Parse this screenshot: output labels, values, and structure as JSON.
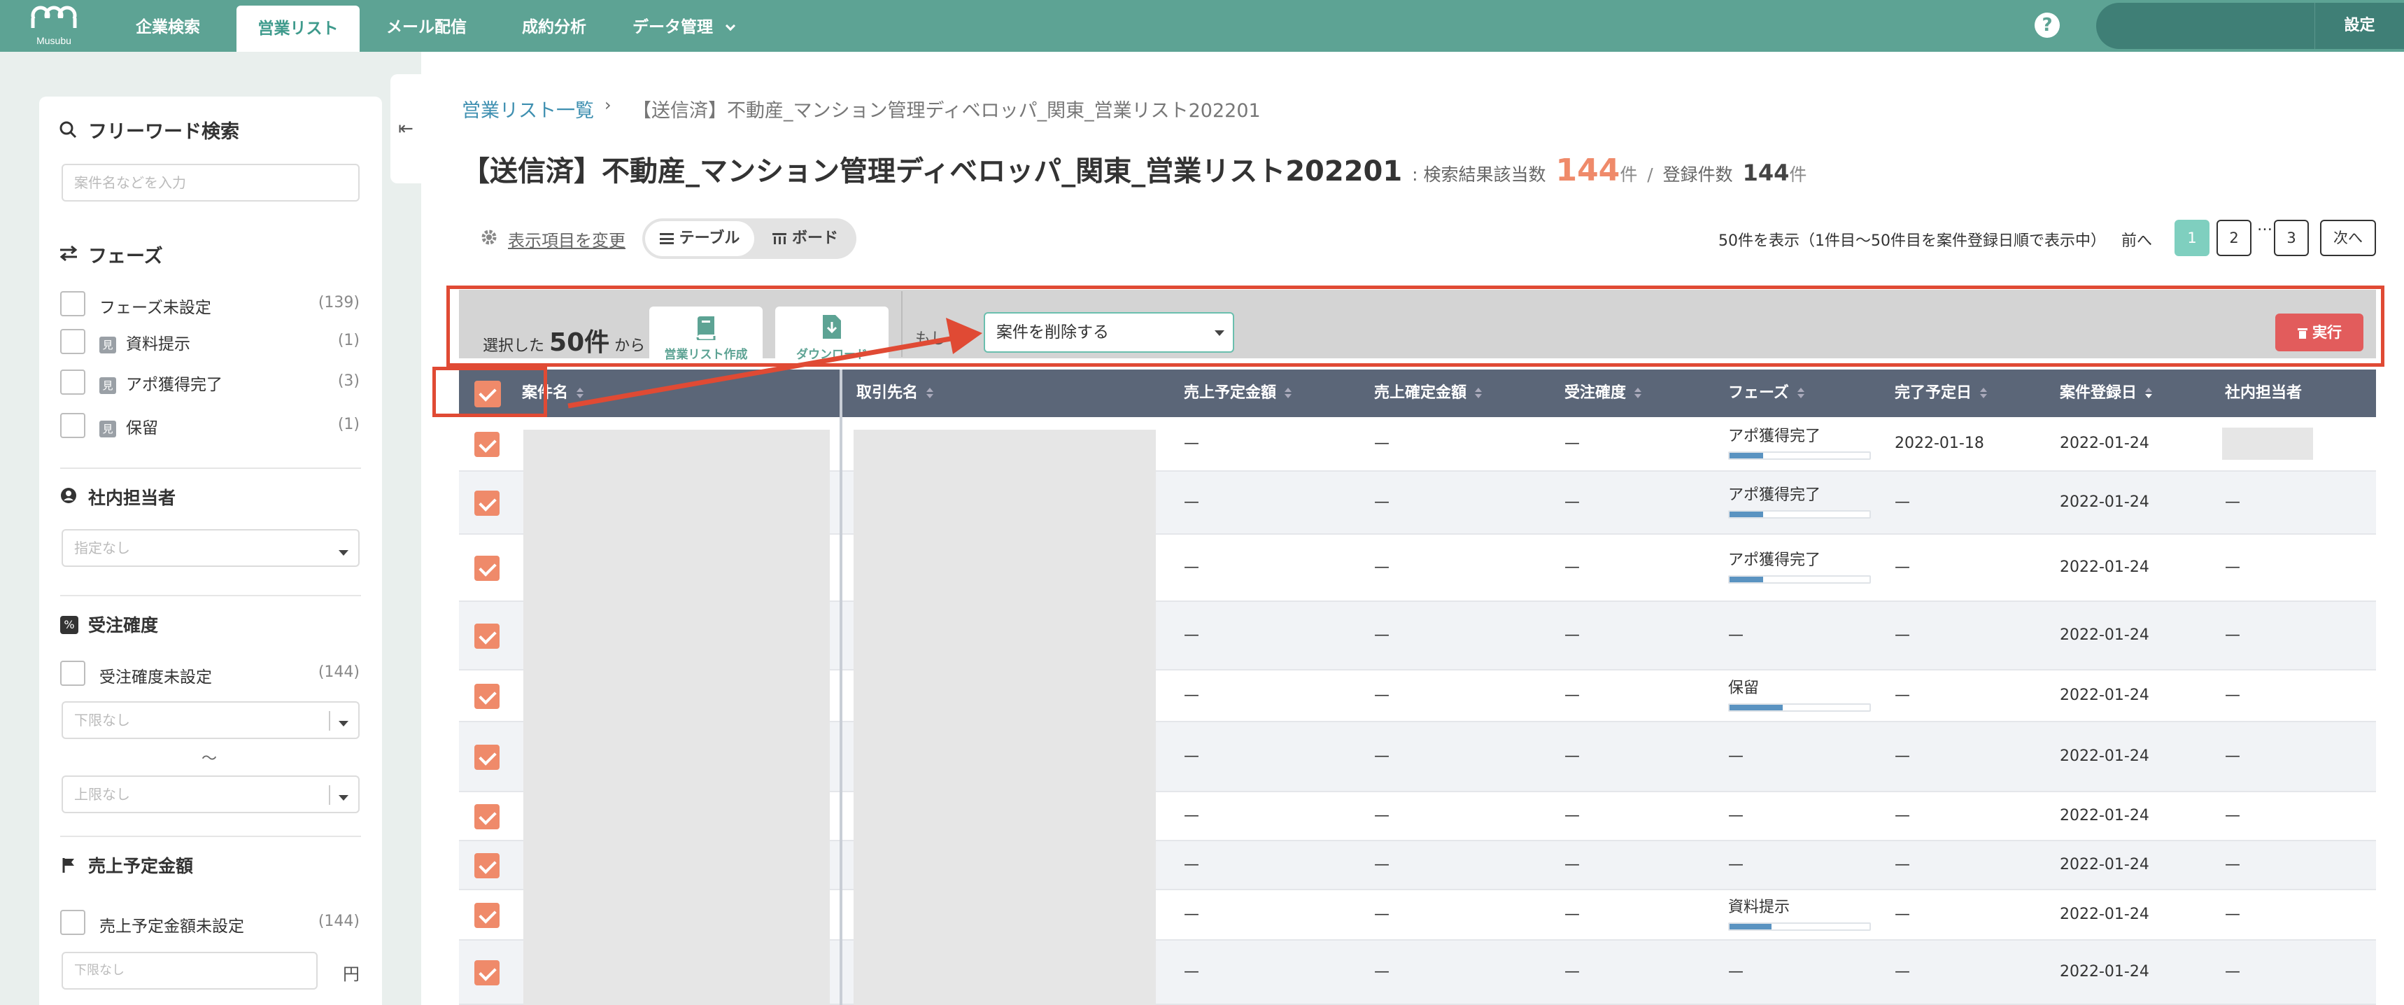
{
  "header": {
    "logo_text": "Musubu",
    "nav": [
      "企業検索",
      "営業リスト",
      "メール配信",
      "成約分析",
      "データ管理"
    ],
    "active_nav": "営業リスト",
    "help": "?",
    "settings": "設定"
  },
  "sidebar": {
    "freeword_title": "フリーワード検索",
    "freeword_placeholder": "案件名などを入力",
    "phase_title": "フェーズ",
    "phase_items": [
      {
        "label": "フェーズ未設定",
        "count": "(139)",
        "tag": ""
      },
      {
        "label": "資料提示",
        "count": "(1)",
        "tag": "見"
      },
      {
        "label": "アポ獲得完了",
        "count": "(3)",
        "tag": "見"
      },
      {
        "label": "保留",
        "count": "(1)",
        "tag": "見"
      }
    ],
    "owner_title": "社内担当者",
    "owner_select": "指定なし",
    "prob_title": "受注確度",
    "prob_unset_label": "受注確度未設定",
    "prob_unset_count": "(144)",
    "prob_lower": "下限なし",
    "prob_tilde": "〜",
    "prob_upper": "上限なし",
    "sales_title": "売上予定金額",
    "sales_unset_label": "売上予定金額未設定",
    "sales_unset_count": "(144)",
    "sales_lower": "下限なし",
    "sales_unit": "円"
  },
  "breadcrumb": {
    "link": "営業リスト一覧",
    "sep": "›",
    "current": "【送信済】不動産_マンション管理ディベロッパ_関東_営業リスト202201"
  },
  "title": {
    "name": "【送信済】不動産_マンション管理ディベロッパ_関東_営業リスト202201",
    "result_label": ": 検索結果該当数",
    "result_count": "144",
    "unit": "件",
    "slash": "/",
    "registered_label": "登録件数",
    "registered_count": "144"
  },
  "toolbar": {
    "column_settings": "表示項目を変更",
    "view_table": "テーブル",
    "view_board": "ボード",
    "page_info": "50件を表示（1件目〜50件目を案件登録日順で表示中）",
    "prev": "前へ",
    "pages": [
      "1",
      "2",
      "3"
    ],
    "dots": "…",
    "next": "次へ"
  },
  "actionbar": {
    "selected_prefix": "選択した",
    "selected_count": "50件",
    "selected_suffix": "から",
    "create_list": "営業リスト作成",
    "download": "ダウンロード",
    "moshi": "もし",
    "action_select": "案件を削除する",
    "execute": "実行"
  },
  "table": {
    "headers": [
      "案件名",
      "取引先名",
      "売上予定金額",
      "売上確定金額",
      "受注確度",
      "フェーズ",
      "完了予定日",
      "案件登録日",
      "社内担当者"
    ],
    "rows": [
      {
        "sales": "—",
        "confirmed": "—",
        "prob": "—",
        "phase": "アポ獲得完了",
        "progress": 0.24,
        "due": "2022-01-18",
        "registered": "2022-01-24",
        "owner": ""
      },
      {
        "sales": "—",
        "confirmed": "—",
        "prob": "—",
        "phase": "アポ獲得完了",
        "progress": 0.24,
        "due": "—",
        "registered": "2022-01-24",
        "owner": "—"
      },
      {
        "sales": "—",
        "confirmed": "—",
        "prob": "—",
        "phase": "アポ獲得完了",
        "progress": 0.24,
        "due": "—",
        "registered": "2022-01-24",
        "owner": "—"
      },
      {
        "sales": "—",
        "confirmed": "—",
        "prob": "—",
        "phase": "—",
        "progress": null,
        "due": "—",
        "registered": "2022-01-24",
        "owner": "—"
      },
      {
        "sales": "—",
        "confirmed": "—",
        "prob": "—",
        "phase": "保留",
        "progress": 0.38,
        "due": "—",
        "registered": "2022-01-24",
        "owner": "—"
      },
      {
        "sales": "—",
        "confirmed": "—",
        "prob": "—",
        "phase": "—",
        "progress": null,
        "due": "—",
        "registered": "2022-01-24",
        "owner": "—"
      },
      {
        "sales": "—",
        "confirmed": "—",
        "prob": "—",
        "phase": "—",
        "progress": null,
        "due": "—",
        "registered": "2022-01-24",
        "owner": "—"
      },
      {
        "sales": "—",
        "confirmed": "—",
        "prob": "—",
        "phase": "—",
        "progress": null,
        "due": "—",
        "registered": "2022-01-24",
        "owner": "—"
      },
      {
        "sales": "—",
        "confirmed": "—",
        "prob": "—",
        "phase": "資料提示",
        "progress": 0.3,
        "due": "—",
        "registered": "2022-01-24",
        "owner": "—"
      },
      {
        "sales": "—",
        "confirmed": "—",
        "prob": "—",
        "phase": "—",
        "progress": null,
        "due": "—",
        "registered": "2022-01-24",
        "owner": "—"
      }
    ]
  },
  "colors": {
    "brand": "#5da394",
    "accent": "#ef8a6a",
    "annotation": "#e04a34",
    "danger": "#e25c5c",
    "table_header": "#5b6678"
  }
}
